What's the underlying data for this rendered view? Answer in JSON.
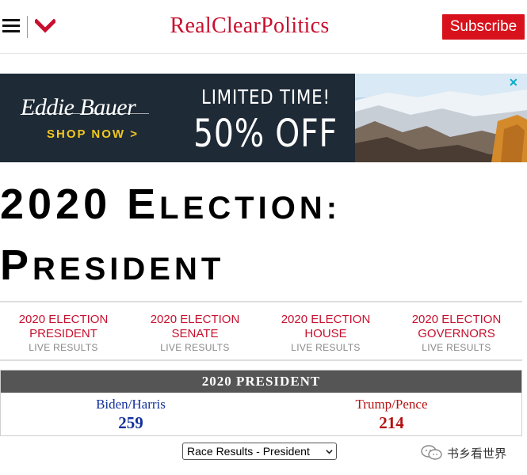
{
  "header": {
    "logo": "RealClearPolitics",
    "subscribe_label": "Subscribe"
  },
  "ad": {
    "brand": "Eddie Bauer",
    "cta": "SHOP NOW >",
    "headline": "LIMITED TIME!",
    "offer": "50% OFF"
  },
  "page_title": {
    "line1_lead": "2020 E",
    "line1_rest": "LECTION:",
    "line2_lead": "P",
    "line2_rest": "RESIDENT"
  },
  "nav": {
    "items": [
      {
        "label": "2020 ELECTION PRESIDENT",
        "sub": "LIVE RESULTS"
      },
      {
        "label": "2020 ELECTION SENATE",
        "sub": "LIVE RESULTS"
      },
      {
        "label": "2020 ELECTION HOUSE",
        "sub": "LIVE RESULTS"
      },
      {
        "label": "2020 ELECTION GOVERNORS",
        "sub": "LIVE RESULTS"
      }
    ]
  },
  "results": {
    "heading": "2020 PRESIDENT",
    "candidates": [
      {
        "name": "Biden/Harris",
        "votes": "259",
        "color": "#14309a"
      },
      {
        "name": "Trump/Pence",
        "votes": "214",
        "color": "#b51212"
      }
    ]
  },
  "race_select": {
    "selected": "Race Results - President"
  },
  "watermark": {
    "text": "书乡看世界"
  },
  "colors": {
    "brand_red": "#c8102e",
    "subscribe_bg": "#d8121c",
    "ad_bg": "#1e2a36",
    "ad_accent": "#f2c81d",
    "results_header": "#555555"
  },
  "icons": [
    "menu-icon",
    "chevron-down-icon",
    "close-icon",
    "wechat-icon"
  ]
}
